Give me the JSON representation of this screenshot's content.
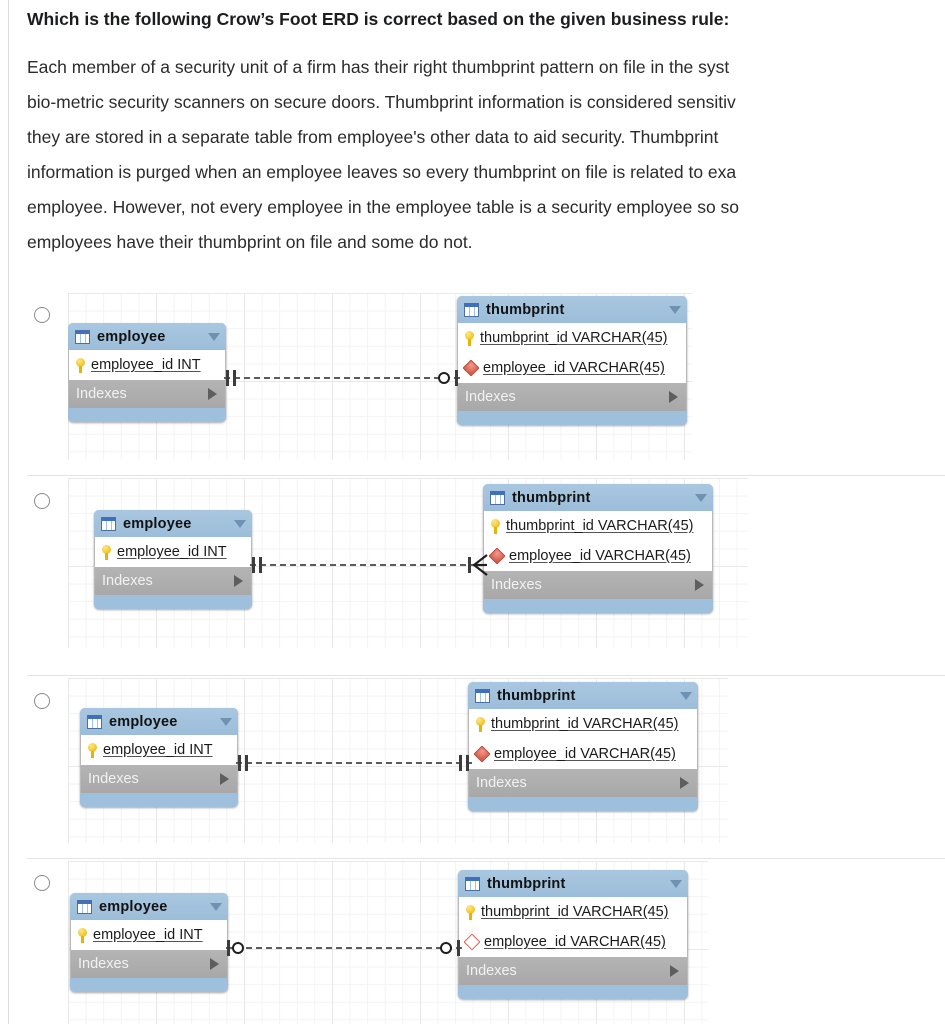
{
  "question": {
    "title": "Which is the following Crow’s Foot ERD is correct based on the given business rule:",
    "body_lines": [
      "Each member of a security unit of a firm has their right thumbprint pattern on file in the syst",
      "bio-metric security scanners on secure doors. Thumbprint information is considered sensitiv",
      "they are stored in a separate table from employee's other data to aid security.  Thumbprint",
      "information is purged when an employee leaves so every thumbprint on file is related to exa",
      "employee. However, not every employee in the employee table is a security employee so so",
      "employees have their thumbprint on file and some do not."
    ]
  },
  "labels": {
    "employee_table": "employee",
    "thumbprint_table": "thumbprint",
    "employee_pk": "employee_id INT",
    "thumbprint_pk": "thumbprint_id VARCHAR(45)",
    "thumbprint_fk": "employee_id VARCHAR(45)",
    "indexes": "Indexes"
  },
  "colors": {
    "table_header": "#9fc0dc",
    "table_footer": "#9fc0dc",
    "indexes_row": "#aeaeae",
    "field_row": "#ffffff",
    "key_icon": "#e8b400",
    "fk_filled": "#cf4b37",
    "fk_hollow": "#d9604c",
    "connector": "#5b5b5b",
    "grid_line": "#e9e9e9"
  },
  "options": [
    {
      "id": "option-a",
      "selected": false,
      "left_cardinality": "one-and-only-one",
      "right_cardinality": "zero-or-one",
      "fk_nullable": false
    },
    {
      "id": "option-b",
      "selected": false,
      "left_cardinality": "one-and-only-one",
      "right_cardinality": "one-or-many",
      "fk_nullable": false
    },
    {
      "id": "option-c",
      "selected": false,
      "left_cardinality": "one-and-only-one",
      "right_cardinality": "one-and-only-one",
      "fk_nullable": false
    },
    {
      "id": "option-d",
      "selected": false,
      "left_cardinality": "zero-or-one",
      "right_cardinality": "zero-or-one",
      "fk_nullable": true
    }
  ]
}
